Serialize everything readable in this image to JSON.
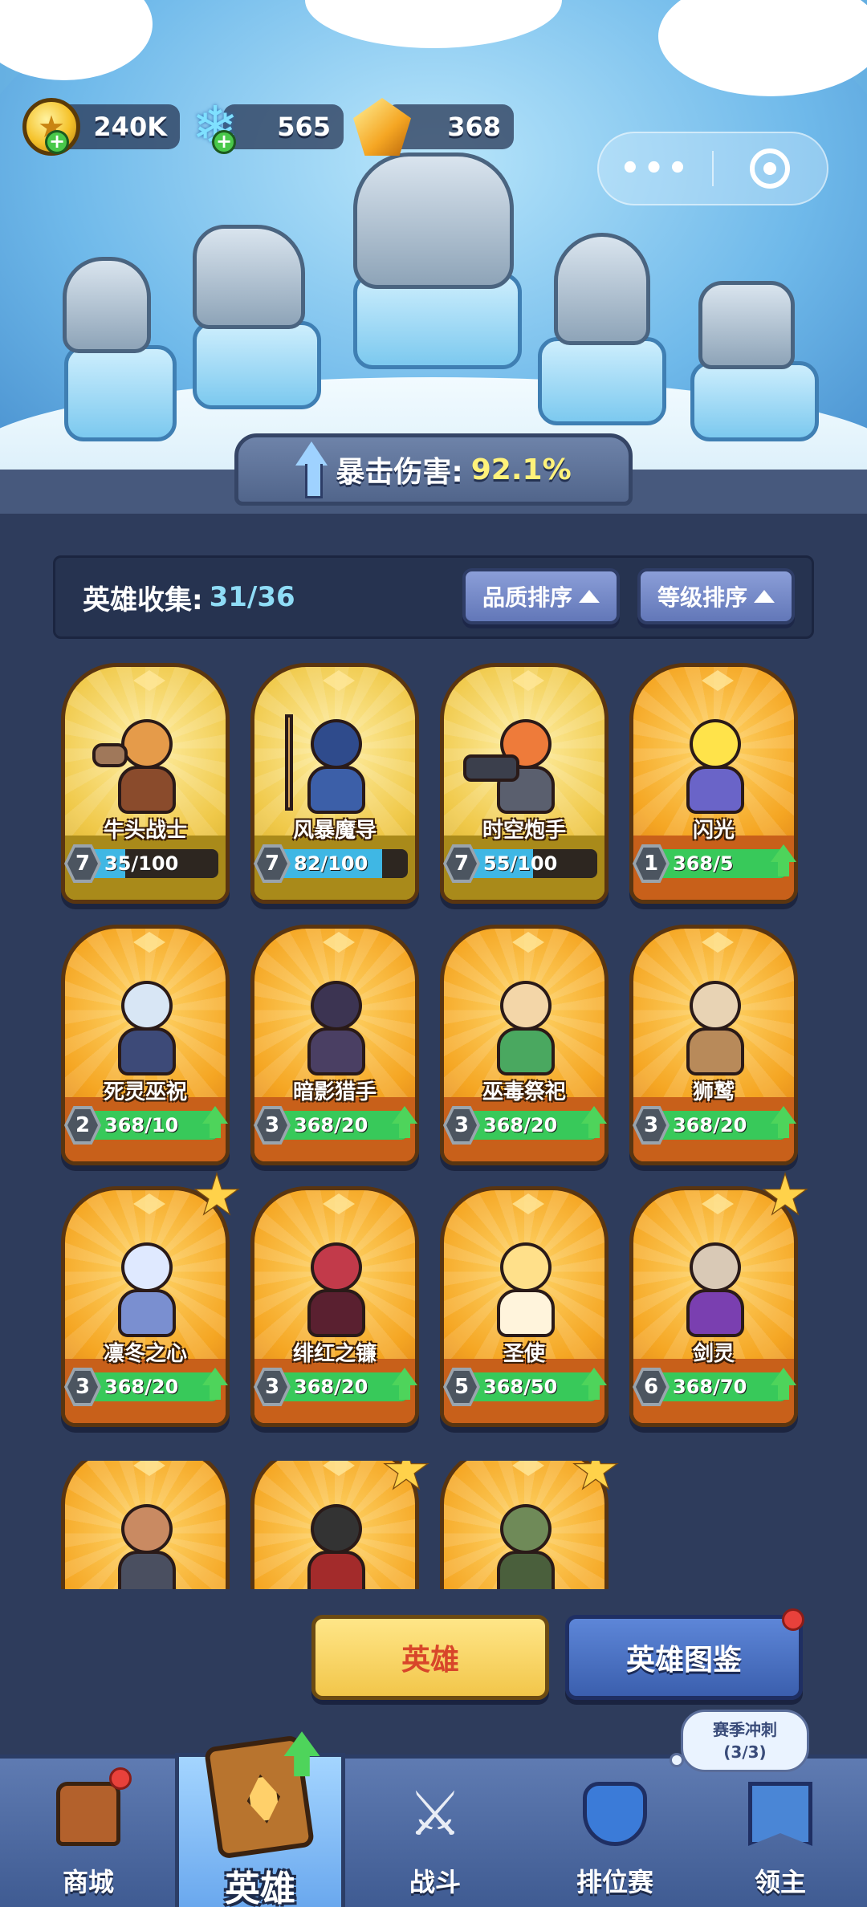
{
  "currencies": [
    {
      "icon": "gold-coin-icon",
      "value": "240K"
    },
    {
      "icon": "ice-crystal-icon",
      "value": "565"
    },
    {
      "icon": "gold-crystal-icon",
      "value": "368"
    }
  ],
  "bonus": {
    "label": "暴击伤害:",
    "value": "92.1%"
  },
  "collection": {
    "label": "英雄收集:",
    "value": "31/36"
  },
  "sort": {
    "quality": "品质排序",
    "level": "等级排序"
  },
  "heroes": [
    {
      "name": "牛头战士",
      "level": "7",
      "progress": "35/100",
      "fill": 0.35,
      "rarity": "epic"
    },
    {
      "name": "风暴魔导",
      "level": "7",
      "progress": "82/100",
      "fill": 0.82,
      "rarity": "epic"
    },
    {
      "name": "时空炮手",
      "level": "7",
      "progress": "55/100",
      "fill": 0.55,
      "rarity": "epic"
    },
    {
      "name": "闪光",
      "level": "1",
      "progress": "368/5",
      "fill": 1,
      "rarity": "legend"
    },
    {
      "name": "死灵巫祝",
      "level": "2",
      "progress": "368/10",
      "fill": 1,
      "rarity": "legend"
    },
    {
      "name": "暗影猎手",
      "level": "3",
      "progress": "368/20",
      "fill": 1,
      "rarity": "legend"
    },
    {
      "name": "巫毒祭祀",
      "level": "3",
      "progress": "368/20",
      "fill": 1,
      "rarity": "legend"
    },
    {
      "name": "狮鹫",
      "level": "3",
      "progress": "368/20",
      "fill": 1,
      "rarity": "legend"
    },
    {
      "name": "凛冬之心",
      "level": "3",
      "progress": "368/20",
      "fill": 1,
      "rarity": "legend"
    },
    {
      "name": "绯红之镰",
      "level": "3",
      "progress": "368/20",
      "fill": 1,
      "rarity": "legend"
    },
    {
      "name": "圣使",
      "level": "5",
      "progress": "368/50",
      "fill": 1,
      "rarity": "legend"
    },
    {
      "name": "剑灵",
      "level": "6",
      "progress": "368/70",
      "fill": 1,
      "rarity": "legend"
    }
  ],
  "tabs": {
    "hero": "英雄",
    "codex": "英雄图鉴"
  },
  "season": {
    "line1": "赛季冲刺",
    "line2": "(3/3)"
  },
  "nav": {
    "shop": "商城",
    "hero": "英雄",
    "battle": "战斗",
    "ranked": "排位赛",
    "lord": "领主"
  }
}
